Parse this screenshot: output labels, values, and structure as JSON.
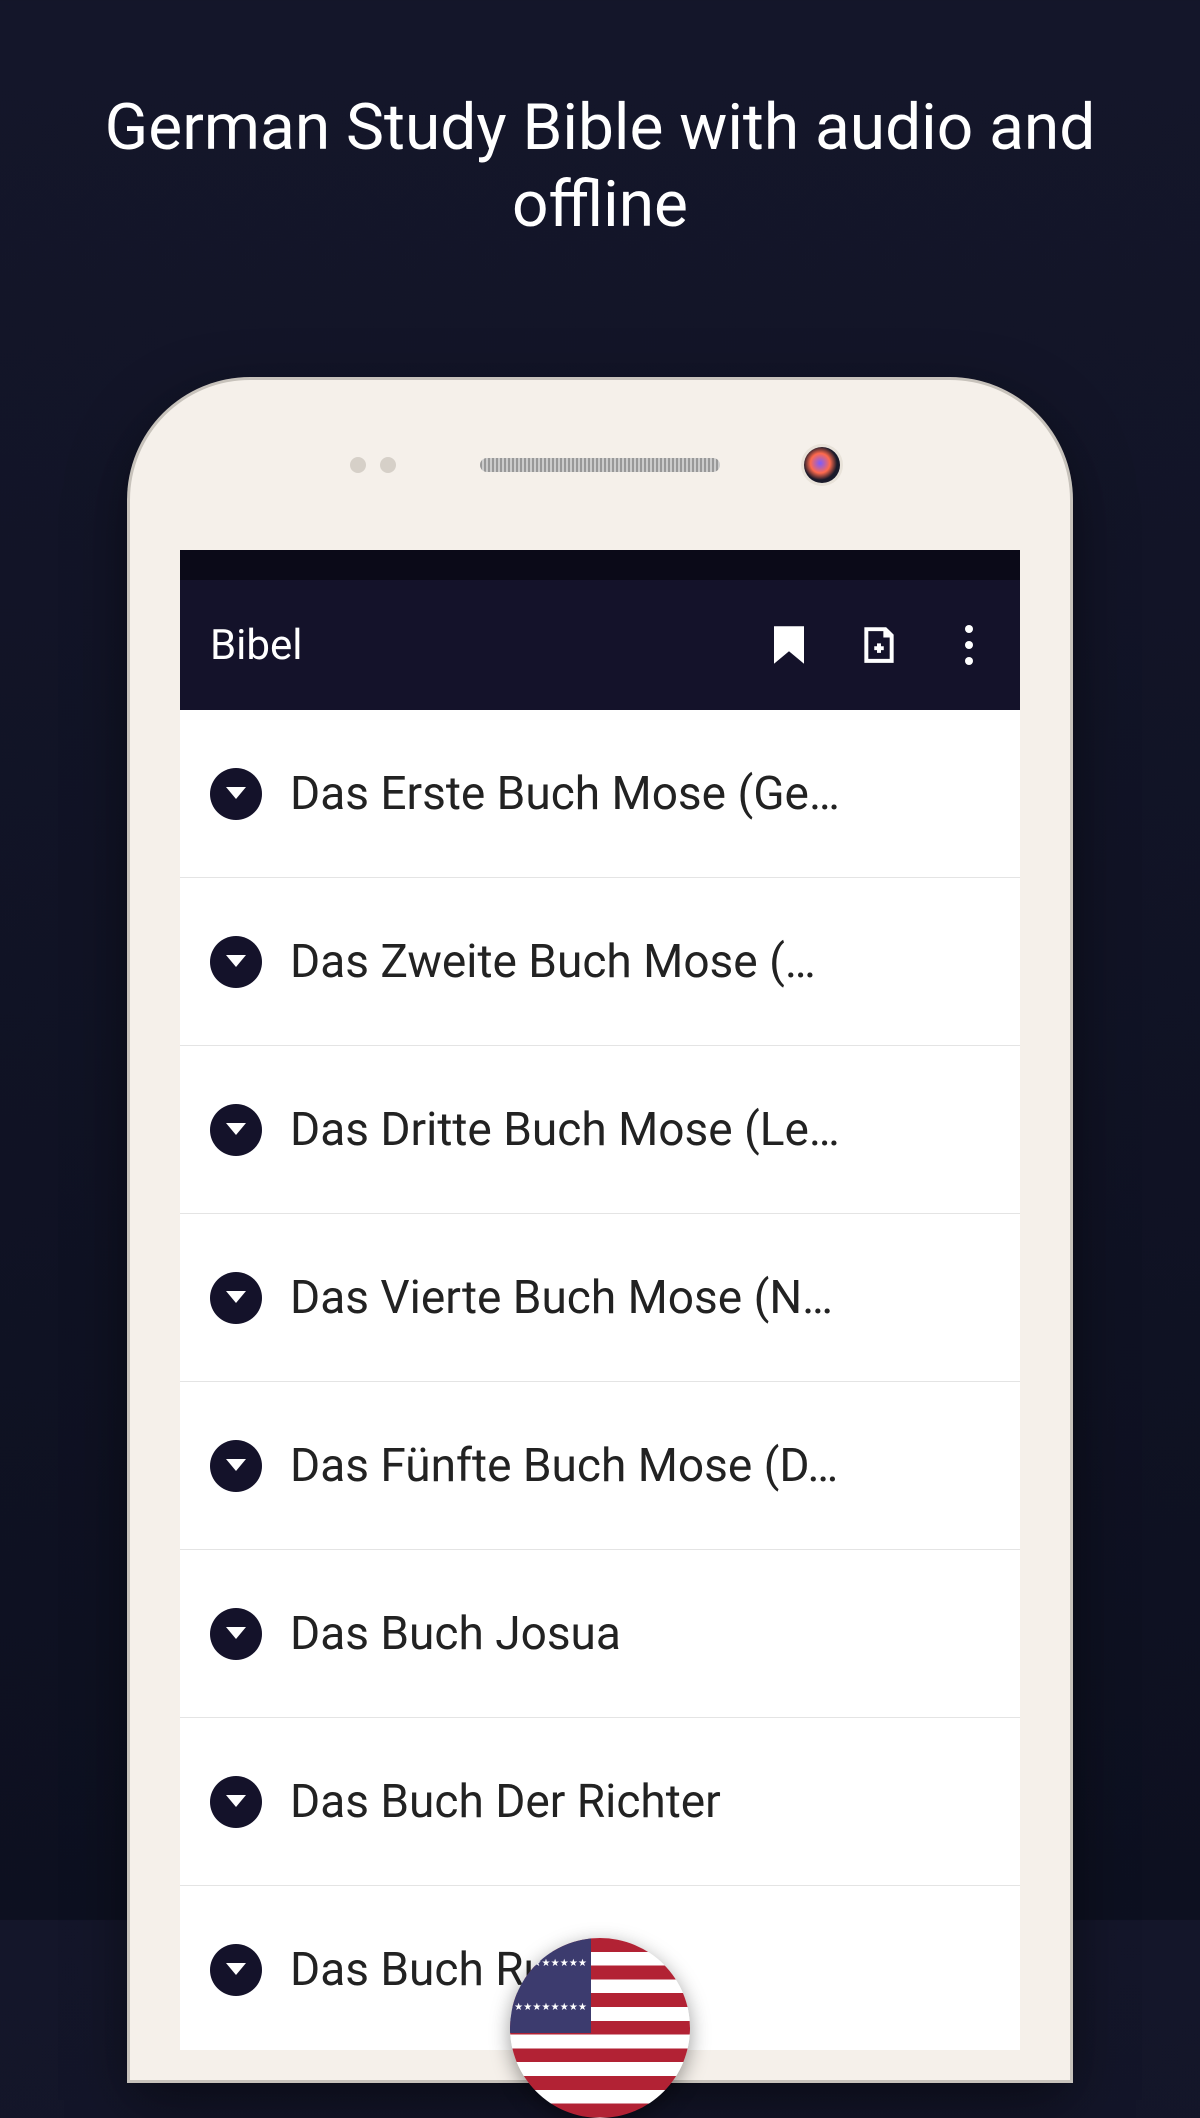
{
  "headline": "German Study Bible with audio and offline",
  "app": {
    "title": "Bibel",
    "icons": {
      "bookmark": "bookmark-icon",
      "note": "note-add-icon",
      "overflow": "overflow-menu-icon"
    }
  },
  "books": [
    {
      "label": "Das Erste Buch Mose (Ge…"
    },
    {
      "label": "Das Zweite Buch Mose (…"
    },
    {
      "label": "Das Dritte Buch Mose (Le…"
    },
    {
      "label": "Das Vierte Buch Mose (N…"
    },
    {
      "label": "Das Fünfte Buch Mose (D…"
    },
    {
      "label": "Das Buch Josua"
    },
    {
      "label": "Das Buch Der Richter"
    },
    {
      "label": "Das Buch Ruth"
    }
  ],
  "flag": {
    "country": "United States"
  }
}
